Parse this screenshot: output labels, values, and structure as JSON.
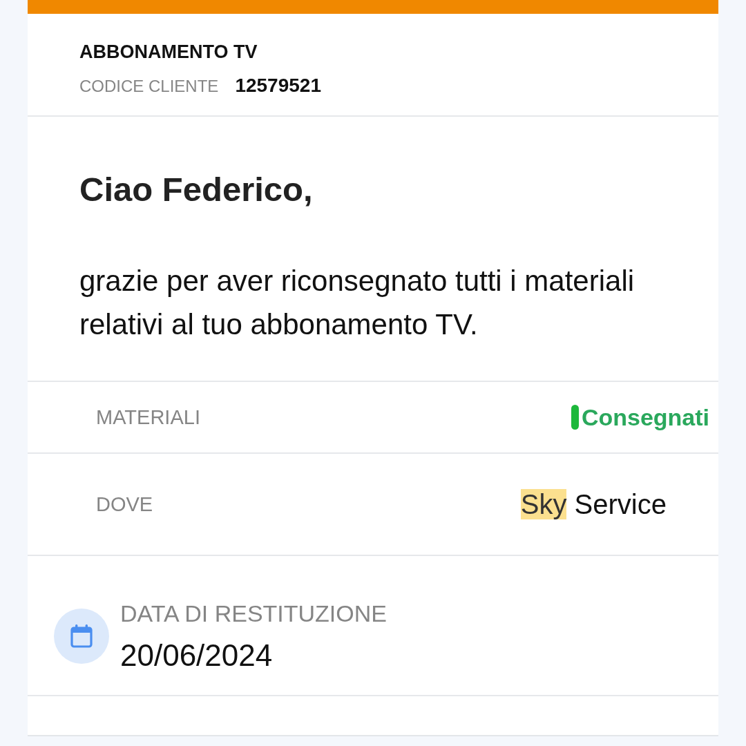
{
  "header": {
    "title": "ABBONAMENTO TV",
    "customer_code": {
      "label": "CODICE CLIENTE",
      "value": "12579521"
    }
  },
  "message": {
    "greeting": "Ciao Federico,",
    "body": "grazie per aver riconsegnato tutti i materiali relativi al tuo abbonamento TV."
  },
  "details": [
    {
      "kind": "status",
      "label": "MATERIALI",
      "value": "Consegnati",
      "color": "#1db83b"
    },
    {
      "kind": "text",
      "label": "DOVE",
      "value_parts": [
        {
          "text": "Sky",
          "highlighted": true
        },
        {
          "text": "Service",
          "highlighted": false
        }
      ]
    }
  ],
  "return_date": {
    "label": "DATA DI RESTITUZIONE",
    "value": "20/06/2024"
  }
}
